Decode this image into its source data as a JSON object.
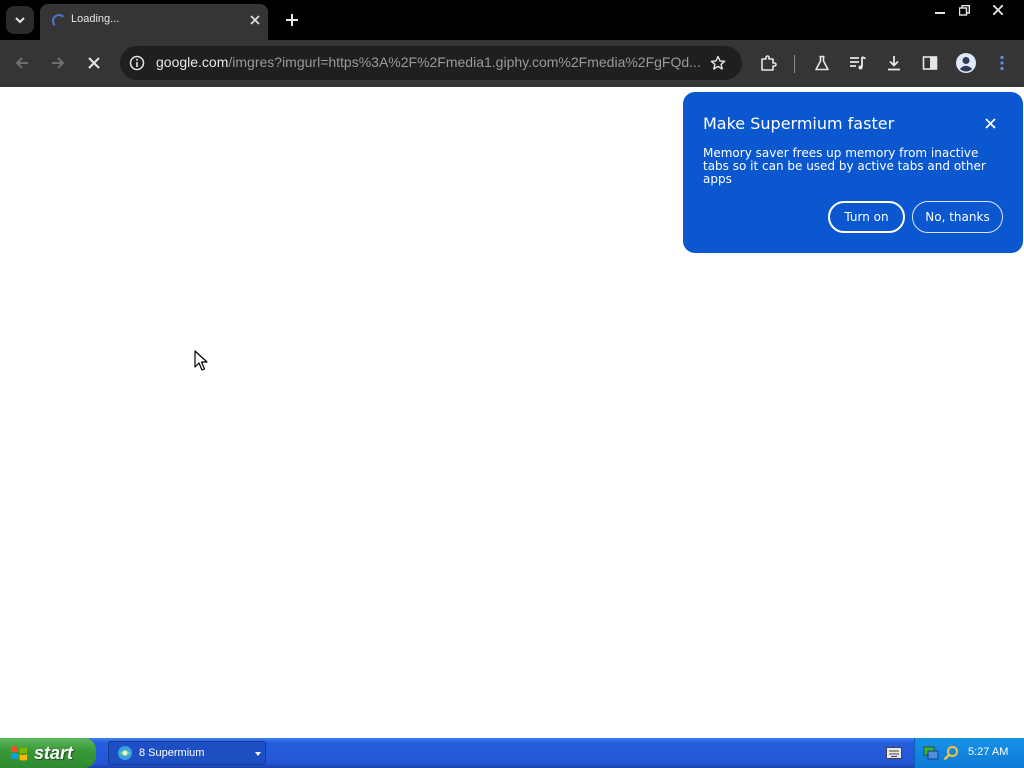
{
  "tab": {
    "title": "Loading...",
    "search_icon": "chevron-down-icon",
    "close_icon": "close-icon",
    "new_tab_icon": "plus-icon"
  },
  "window_controls": [
    "minimize-icon",
    "restore-icon",
    "close-icon"
  ],
  "toolbar": {
    "url_host": "google.com",
    "url_path": "/imgres?imgurl=https%3A%2F%2Fmedia1.giphy.com%2Fmedia%2FgFQd...",
    "icons": [
      "back-icon",
      "forward-icon",
      "stop-icon",
      "site-info-icon",
      "star-icon",
      "extensions-icon",
      "labs-icon",
      "media-control-icon",
      "download-icon",
      "side-panel-icon",
      "profile-icon",
      "menu-icon"
    ]
  },
  "bubble": {
    "title": "Make Supermium faster",
    "body": "Memory saver frees up memory from inactive tabs so it can be used by active tabs and other apps",
    "turn_on_label": "Turn on",
    "no_thanks_label": "No, thanks",
    "background_color": "#0b57d0"
  },
  "taskbar": {
    "start_label": "start",
    "task_label": "8 Supermium",
    "clock": "5:27 AM"
  }
}
